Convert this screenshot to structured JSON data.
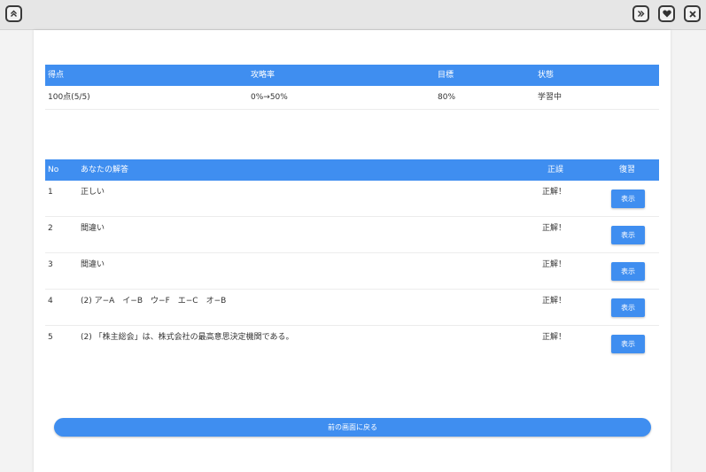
{
  "toolbar": {
    "collapse_icon": "double-chevron-up-icon",
    "forward_icon": "double-chevron-right-icon",
    "favorite_icon": "heart-icon",
    "close_icon": "close-icon"
  },
  "score_table": {
    "headers": [
      "得点",
      "攻略率",
      "目標",
      "状態"
    ],
    "row": [
      "100点(5/5)",
      "0%→50%",
      "80%",
      "学習中"
    ]
  },
  "answers_table": {
    "headers": {
      "no": "No",
      "answer": "あなたの解答",
      "result": "正誤",
      "review": "復習"
    },
    "rows": [
      {
        "no": "1",
        "answer": "正しい",
        "result": "正解！",
        "button": "表示"
      },
      {
        "no": "2",
        "answer": "間違い",
        "result": "正解！",
        "button": "表示"
      },
      {
        "no": "3",
        "answer": "間違い",
        "result": "正解！",
        "button": "表示"
      },
      {
        "no": "4",
        "answer": "(2) ア−A　イ−B　ウ−F　エ−C　オ−B",
        "result": "正解！",
        "button": "表示"
      },
      {
        "no": "5",
        "answer": "(2) 「株主総会」は、株式会社の最高意思決定機関である。",
        "result": "正解！",
        "button": "表示"
      }
    ]
  },
  "back_button": "前の画面に戻る",
  "colors": {
    "accent": "#3f8ef0",
    "topbar": "#e6e6e6"
  }
}
